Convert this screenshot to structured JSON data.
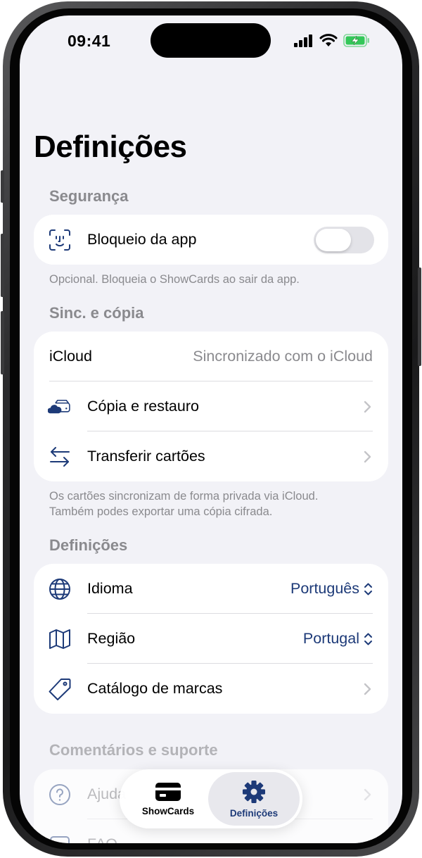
{
  "status_bar": {
    "time": "09:41"
  },
  "page_title": "Definições",
  "security": {
    "header": "Segurança",
    "app_lock_label": "Bloqueio da app",
    "footer": "Opcional. Bloqueia o ShowCards ao sair da app."
  },
  "sync": {
    "header": "Sinc. e cópia",
    "icloud_label": "iCloud",
    "icloud_status": "Sincronizado com o iCloud",
    "backup_label": "Cópia e restauro",
    "transfer_label": "Transferir cartões",
    "footer_line1": "Os cartões sincronizam de forma privada via iCloud.",
    "footer_line2": "Também podes exportar uma cópia cifrada."
  },
  "settings": {
    "header": "Definições",
    "language_label": "Idioma",
    "language_value": "Português",
    "region_label": "Região",
    "region_value": "Portugal",
    "brands_label": "Catálogo de marcas"
  },
  "support": {
    "header": "Comentários e suporte",
    "help_label": "Ajuda",
    "faq_label": "FAQ"
  },
  "tabbar": {
    "tabs": [
      {
        "label": "ShowCards",
        "icon": "card-icon",
        "active": false
      },
      {
        "label": "Definições",
        "icon": "gear-icon",
        "active": true
      }
    ]
  },
  "colors": {
    "accent": "#1d3a78",
    "background": "#f2f2f7",
    "secondary_text": "#8a8a8e",
    "battery_green": "#34c759"
  }
}
